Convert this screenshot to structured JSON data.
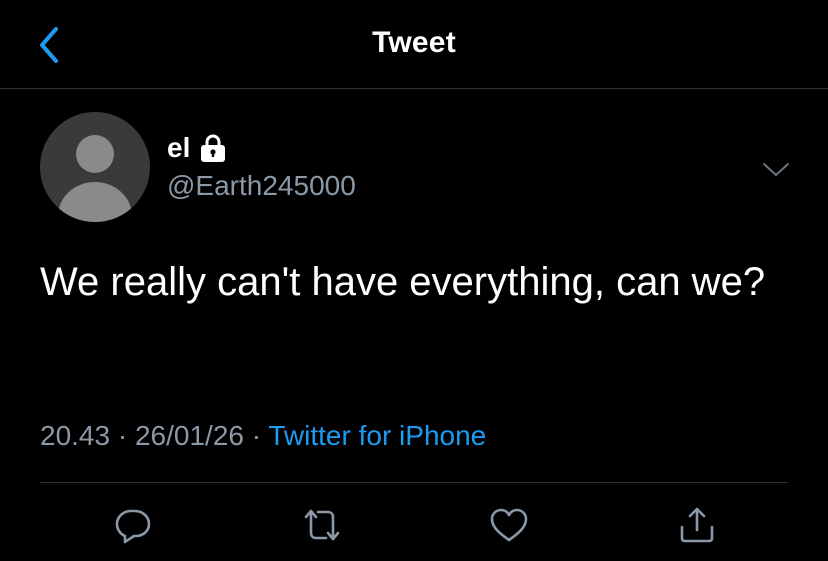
{
  "header": {
    "back_icon": "chevron-left-icon",
    "title": "Tweet"
  },
  "tweet": {
    "author": {
      "display_name": "el",
      "handle": "@Earth245000",
      "protected_icon": "lock-icon",
      "avatar": "default-avatar"
    },
    "text": "We really can't have everything, can we?",
    "time": "20.43",
    "date": "26/01/26",
    "separator": "·",
    "source": "Twitter for iPhone",
    "menu_icon": "chevron-down-icon"
  },
  "actions": [
    {
      "name": "reply",
      "icon": "reply-icon"
    },
    {
      "name": "retweet",
      "icon": "retweet-icon"
    },
    {
      "name": "like",
      "icon": "heart-icon"
    },
    {
      "name": "share",
      "icon": "share-icon"
    }
  ],
  "colors": {
    "background": "#000000",
    "text_primary": "#ffffff",
    "text_secondary": "#8b98a5",
    "accent": "#1d9bf0",
    "divider": "#2f3336"
  }
}
